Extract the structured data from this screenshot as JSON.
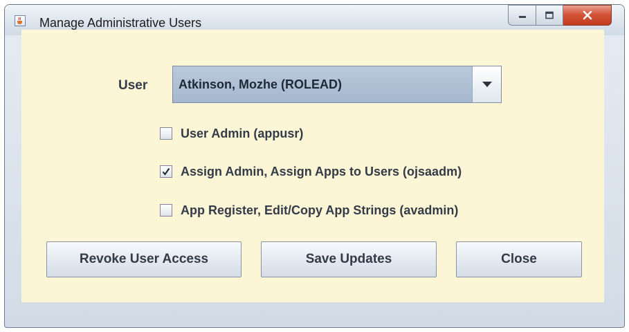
{
  "window": {
    "title": "Manage Administrative Users",
    "app_icon": "java-cup-icon",
    "controls": [
      "minimize-icon",
      "maximize-icon",
      "close-icon"
    ],
    "client_bg": "#fdf6d6"
  },
  "form": {
    "user_label": "User",
    "user_value": "Atkinson, Mozhe (ROLEAD)",
    "checkboxes": [
      {
        "label": "User Admin (appusr)",
        "checked": false
      },
      {
        "label": "Assign Admin, Assign Apps to Users (ojsaadm)",
        "checked": true
      },
      {
        "label": "App Register, Edit/Copy App Strings (avadmin)",
        "checked": false
      }
    ]
  },
  "buttons": {
    "revoke": "Revoke User Access",
    "save": "Save Updates",
    "close": "Close"
  }
}
